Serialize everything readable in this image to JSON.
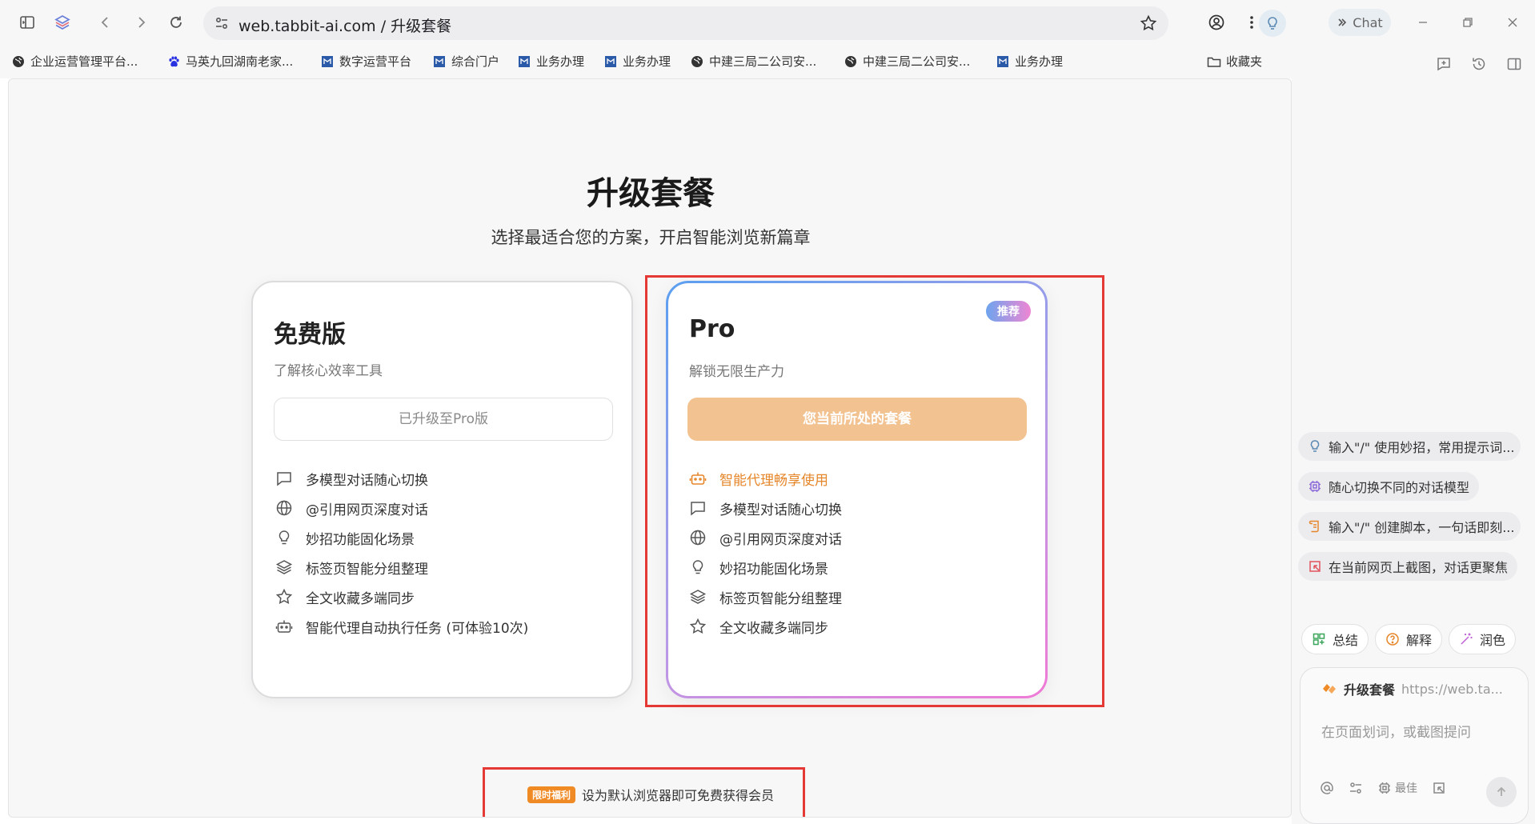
{
  "browser": {
    "url_host": "web.tabbit-ai.com",
    "url_sep": " / ",
    "url_title": "升级套餐",
    "chat_label": "Chat"
  },
  "bookmarks": [
    {
      "label": "企业运营管理平台...",
      "icon": "globe-icon"
    },
    {
      "label": "马英九回湖南老家...",
      "icon": "baidu-paw-icon"
    },
    {
      "label": "数字运营平台",
      "icon": "app-icon"
    },
    {
      "label": "综合门户",
      "icon": "app-icon"
    },
    {
      "label": "业务办理",
      "icon": "app-icon"
    },
    {
      "label": "业务办理",
      "icon": "app-icon"
    },
    {
      "label": "中建三局二公司安...",
      "icon": "globe-icon"
    },
    {
      "label": "中建三局二公司安...",
      "icon": "globe-icon"
    },
    {
      "label": "业务办理",
      "icon": "app-icon"
    }
  ],
  "bookmarks_folder": "收藏夹",
  "page": {
    "title": "升级套餐",
    "subtitle": "选择最适合您的方案，开启智能浏览新篇章"
  },
  "plans": {
    "free": {
      "name": "免费版",
      "desc": "了解核心效率工具",
      "cta": "已升级至Pro版",
      "features": [
        "多模型对话随心切换",
        "@引用网页深度对话",
        "妙招功能固化场景",
        "标签页智能分组整理",
        "全文收藏多端同步",
        "智能代理自动执行任务 (可体验10次)"
      ]
    },
    "pro": {
      "name": "Pro",
      "badge": "推荐",
      "desc": "解锁无限生产力",
      "cta": "您当前所处的套餐",
      "features": [
        "智能代理畅享使用",
        "多模型对话随心切换",
        "@引用网页深度对话",
        "妙招功能固化场景",
        "标签页智能分组整理",
        "全文收藏多端同步"
      ]
    }
  },
  "promo": {
    "tag": "限时福利",
    "text": "设为默认浏览器即可免费获得会员"
  },
  "side_panel": {
    "suggestions": [
      "输入\"/\" 使用妙招，常用提示词...",
      "随心切换不同的对话模型",
      "输入\"/\" 创建脚本，一句话即刻...",
      "在当前网页上截图，对话更聚焦"
    ],
    "chips": [
      "总结",
      "解释",
      "润色"
    ],
    "context_title": "升级套餐",
    "context_url": "https://web.ta...",
    "placeholder": "在页面划词，或截图提问",
    "model_label": "最佳"
  },
  "colors": {
    "accent_orange": "#e6862a",
    "pro_cta": "#f2c291",
    "highlight_red": "#e53935"
  }
}
